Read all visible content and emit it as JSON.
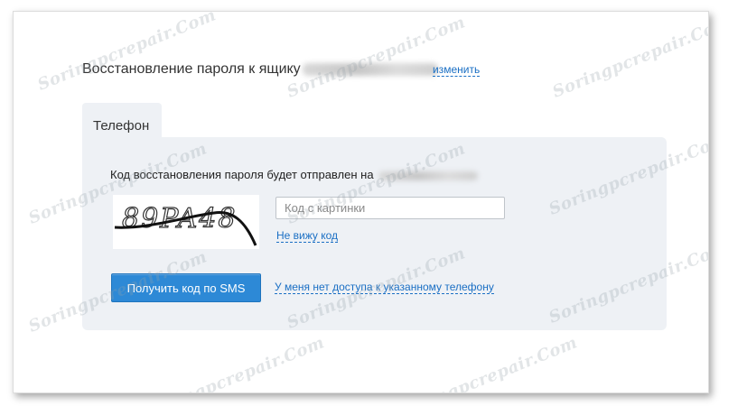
{
  "header": {
    "title": "Восстановление пароля к ящику",
    "change_link": "изменить"
  },
  "tab": {
    "label": "Телефон"
  },
  "panel": {
    "info_text": "Код восстановления пароля будет отправлен на",
    "captcha_text": "89PA48",
    "captcha_placeholder": "Код с картинки",
    "cant_see_link": "Не вижу код",
    "sms_button": "Получить код по SMS",
    "no_access_link": "У меня нет доступа к указанному телефону"
  },
  "watermark": {
    "text": "Soringpcrepair.Com"
  },
  "colors": {
    "accent": "#2d89d6",
    "link": "#1a6fc4",
    "panel_bg": "#eef1f5"
  }
}
